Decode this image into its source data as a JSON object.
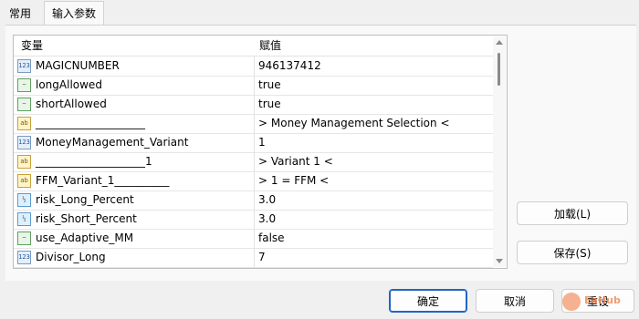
{
  "tabs": [
    {
      "label": "常用"
    },
    {
      "label": "输入参数"
    }
  ],
  "grid": {
    "headers": {
      "variable": "变量",
      "value": "赋值"
    },
    "rows": [
      {
        "icon": "int-icon",
        "icon_text": "123",
        "name": "MAGICNUMBER",
        "value": "946137412"
      },
      {
        "icon": "bool-icon",
        "icon_text": "~",
        "name": "longAllowed",
        "value": "true"
      },
      {
        "icon": "bool-icon",
        "icon_text": "~",
        "name": "shortAllowed",
        "value": "true"
      },
      {
        "icon": "string-icon",
        "icon_text": "ab",
        "name": "____________________",
        "value": "> Money Management Selection <"
      },
      {
        "icon": "int-icon",
        "icon_text": "123",
        "name": "MoneyManagement_Variant",
        "value": "1"
      },
      {
        "icon": "string-icon",
        "icon_text": "ab",
        "name": "____________________1",
        "value": "> Variant 1 <"
      },
      {
        "icon": "string-icon",
        "icon_text": "ab",
        "name": "FFM_Variant_1__________",
        "value": "> 1 = FFM <"
      },
      {
        "icon": "double-icon",
        "icon_text": "½",
        "name": "risk_Long_Percent",
        "value": "3.0"
      },
      {
        "icon": "double-icon",
        "icon_text": "½",
        "name": "risk_Short_Percent",
        "value": "3.0"
      },
      {
        "icon": "bool-icon",
        "icon_text": "~",
        "name": "use_Adaptive_MM",
        "value": "false"
      },
      {
        "icon": "int-icon",
        "icon_text": "123",
        "name": "Divisor_Long",
        "value": "7"
      }
    ]
  },
  "side_buttons": {
    "load": "加载(L)",
    "save": "保存(S)"
  },
  "footer_buttons": {
    "ok": "确定",
    "cancel": "取消",
    "reset": "重设"
  },
  "watermark": {
    "text": "EaHub"
  }
}
